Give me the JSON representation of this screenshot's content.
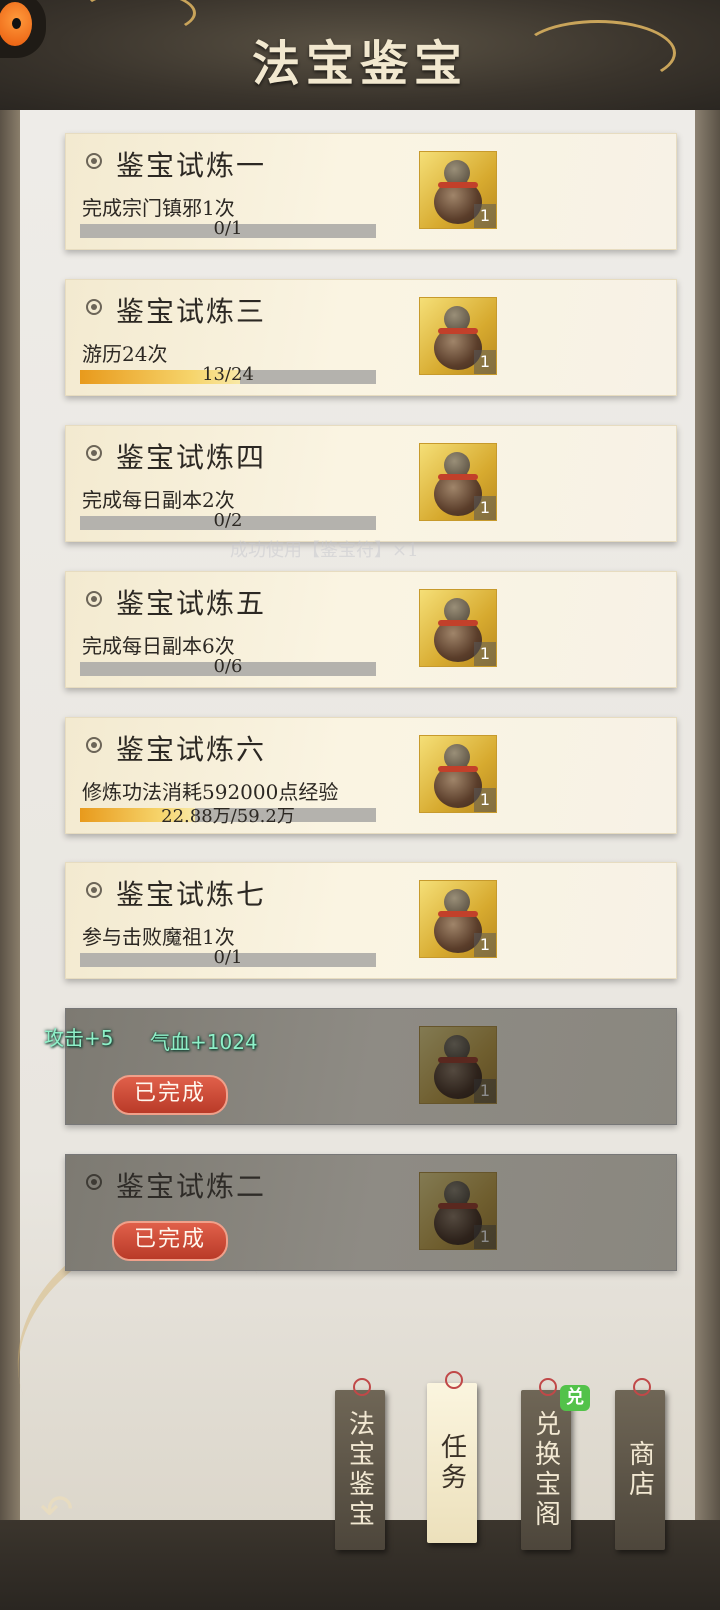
{
  "header": {
    "title": "法宝鉴宝"
  },
  "tasks": [
    {
      "name": "鉴宝试炼一",
      "desc": "完成宗门镇邪1次",
      "progress_text": "0/1",
      "progress": 0.0,
      "qty": "1"
    },
    {
      "name": "鉴宝试炼三",
      "desc": "游历24次",
      "progress_text": "13/24",
      "progress": 0.54,
      "qty": "1"
    },
    {
      "name": "鉴宝试炼四",
      "desc": "完成每日副本2次",
      "progress_text": "0/2",
      "progress": 0.0,
      "qty": "1"
    },
    {
      "name": "鉴宝试炼五",
      "desc": "完成每日副本6次",
      "progress_text": "0/6",
      "progress": 0.0,
      "qty": "1"
    },
    {
      "name": "鉴宝试炼六",
      "desc": "修炼功法消耗592000点经验",
      "progress_text": "22.88万/59.2万",
      "progress": 0.39,
      "qty": "1"
    },
    {
      "name": "鉴宝试炼七",
      "desc": "参与击败魔祖1次",
      "progress_text": "0/1",
      "progress": 0.0,
      "qty": "1"
    }
  ],
  "completed": [
    {
      "name": "",
      "status": "已完成",
      "qty": "1"
    },
    {
      "name": "鉴宝试炼二",
      "status": "已完成",
      "qty": "1"
    }
  ],
  "floating": {
    "attack": "攻击+5",
    "hp": "气血+1024"
  },
  "overlay": "成功使用【鉴宝符】×1",
  "tabs": [
    {
      "label": "法宝鉴宝"
    },
    {
      "label": "任务"
    },
    {
      "label": "兑换宝阁"
    },
    {
      "label": "商店"
    }
  ],
  "exchange_badge": "兑",
  "colors": {
    "progress_fill": "#f0b43a",
    "done_badge": "#c84a36",
    "panel": "#eceae5"
  }
}
